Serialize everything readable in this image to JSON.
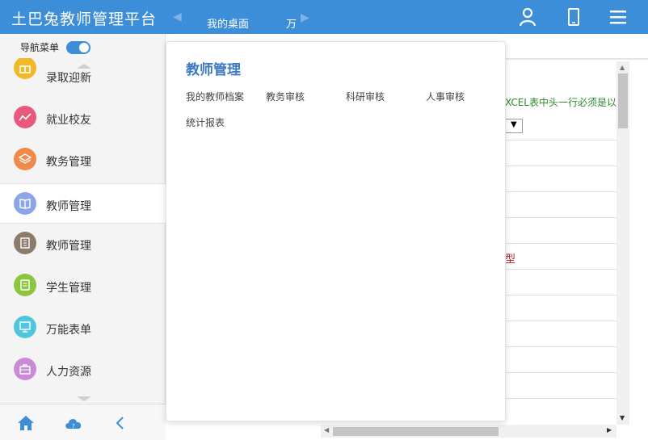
{
  "header": {
    "title": "土巴兔教师管理平台",
    "tabs": [
      {
        "label": "我的桌面"
      },
      {
        "label": "万"
      }
    ],
    "colors": {
      "primary": "#3d8ed9"
    },
    "icons": [
      "user-icon",
      "mobile-icon",
      "menu-icon"
    ]
  },
  "sidebar": {
    "toggle_label": "导航菜单",
    "toggle_on": true,
    "items": [
      {
        "label": "录取迎新",
        "icon": "gift-icon",
        "color": "#f3b82a"
      },
      {
        "label": "就业校友",
        "icon": "trend-icon",
        "color": "#e8597d"
      },
      {
        "label": "教务管理",
        "icon": "layers-icon",
        "color": "#f08a4b"
      },
      {
        "label": "教师管理",
        "icon": "book-icon",
        "color": "#8aa6e8",
        "active": true
      },
      {
        "label": "教师管理",
        "icon": "building-icon",
        "color": "#8c7b6b"
      },
      {
        "label": "学生管理",
        "icon": "document-icon",
        "color": "#8cc540"
      },
      {
        "label": "万能表单",
        "icon": "form-icon",
        "color": "#4fc6dd"
      },
      {
        "label": "人力资源",
        "icon": "briefcase-icon",
        "color": "#c98ad6"
      }
    ],
    "bottom_icons": [
      "home-icon",
      "cloud-help-icon",
      "collapse-icon"
    ]
  },
  "main": {
    "notice": "XCEL表中头一行必须是以",
    "select_symbol": "▼",
    "type_text": "型"
  },
  "popup": {
    "title": "教师管理",
    "links": [
      {
        "label": "我的教师档案"
      },
      {
        "label": "教务审核"
      },
      {
        "label": "科研审核"
      },
      {
        "label": "人事审核"
      },
      {
        "label": "统计报表"
      }
    ]
  }
}
